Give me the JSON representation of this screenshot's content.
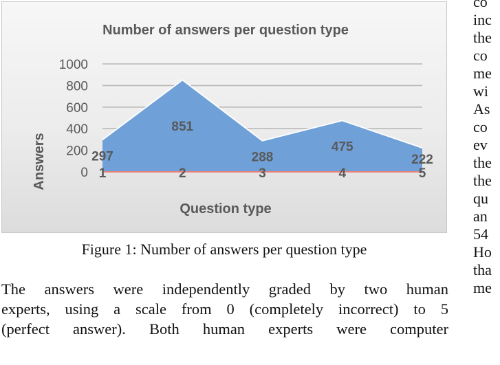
{
  "chart_data": {
    "type": "area",
    "title": "Number of answers per question type",
    "xlabel": "Question type",
    "ylabel": "Answers",
    "categories": [
      "1",
      "2",
      "3",
      "4",
      "5"
    ],
    "values": [
      297,
      851,
      288,
      475,
      222
    ],
    "data_labels": [
      "297",
      "851",
      "288",
      "475",
      "222"
    ],
    "y_ticks": [
      "0",
      "200",
      "400",
      "600",
      "800",
      "1000"
    ],
    "ylim": [
      0,
      1000
    ],
    "grid": true,
    "legend": "none",
    "colors": {
      "area": "#6fa0d8",
      "area_edge": "#ffffff",
      "baseline": "#e8807a",
      "grid": "#b8b8b8",
      "text": "#595959"
    }
  },
  "caption": "Figure 1: Number of answers per question type",
  "body_lines": [
    "The answers were independently graded by two human",
    "experts, using a scale from 0 (completely incorrect) to 5",
    "(perfect answer). Both human experts were computer"
  ],
  "right_column_lines": [
    "co",
    "inc",
    "the",
    "co",
    "me",
    "wi",
    "As",
    "co",
    "ev",
    "the",
    "the",
    "qu",
    "an",
    "54",
    "Ho",
    "tha",
    "me"
  ]
}
